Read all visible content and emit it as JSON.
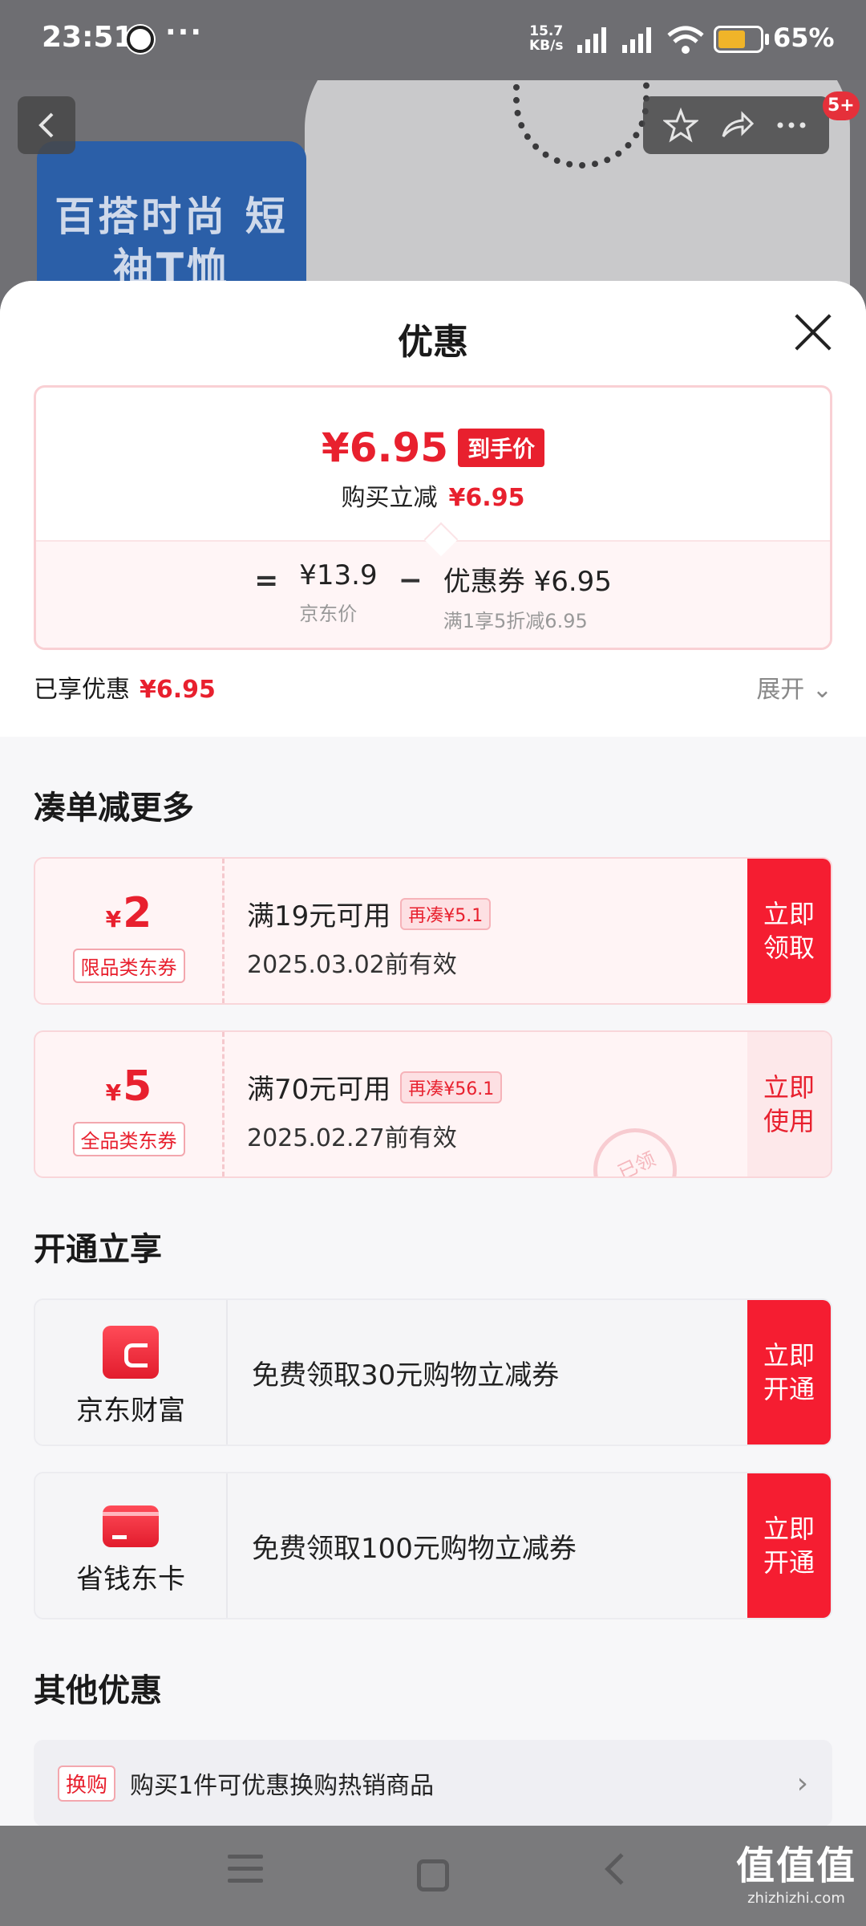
{
  "status_bar": {
    "time": "23:51",
    "dots": "···",
    "net_speed": "15.7",
    "net_unit": "KB/s",
    "battery": "65%",
    "battery_level": 0.65
  },
  "backdrop": {
    "promo_text": "百搭时尚 短袖T恤",
    "badge": "5+"
  },
  "sheet": {
    "title": "优惠"
  },
  "price": {
    "final": "¥6.95",
    "final_tag": "到手价",
    "instant_label": "购买立减",
    "instant_value": "¥6.95",
    "eq": "=",
    "minus": "−",
    "jd_price": "¥13.9",
    "jd_label": "京东价",
    "coupon_line": "优惠券 ¥6.95",
    "coupon_sub": "满1享5折减6.95"
  },
  "enjoyed": {
    "label": "已享优惠",
    "value": "¥6.95",
    "expand": "展开 ⌄"
  },
  "combine": {
    "title": "凑单减更多",
    "coupons": [
      {
        "yen": "¥",
        "amount": "2",
        "type": "限品类东券",
        "condition": "满19元可用",
        "more": "再凑¥5.1",
        "expiry": "2025.03.02前有效",
        "action": "立即 领取"
      },
      {
        "yen": "¥",
        "amount": "5",
        "type": "全品类东券",
        "condition": "满70元可用",
        "more": "再凑¥56.1",
        "expiry": "2025.02.27前有效",
        "action": "立即 使用",
        "stamp": "已领"
      }
    ]
  },
  "open": {
    "title": "开通立享",
    "items": [
      {
        "icon": "wallet-icon",
        "name": "京东财富",
        "desc": "免费领取30元购物立减券",
        "action": "立即 开通"
      },
      {
        "icon": "card-icon",
        "name": "省钱东卡",
        "desc": "免费领取100元购物立减券",
        "action": "立即 开通"
      }
    ]
  },
  "other": {
    "title": "其他优惠",
    "tag": "换购",
    "text": "购买1件可优惠换购热销商品",
    "chevron": "›"
  },
  "watermark": {
    "big": "值值值",
    "small": "zhizhizhi.com"
  },
  "colors": {
    "accent": "#e8202e",
    "button_red": "#f51d31",
    "button_pink": "#fde8ea"
  }
}
